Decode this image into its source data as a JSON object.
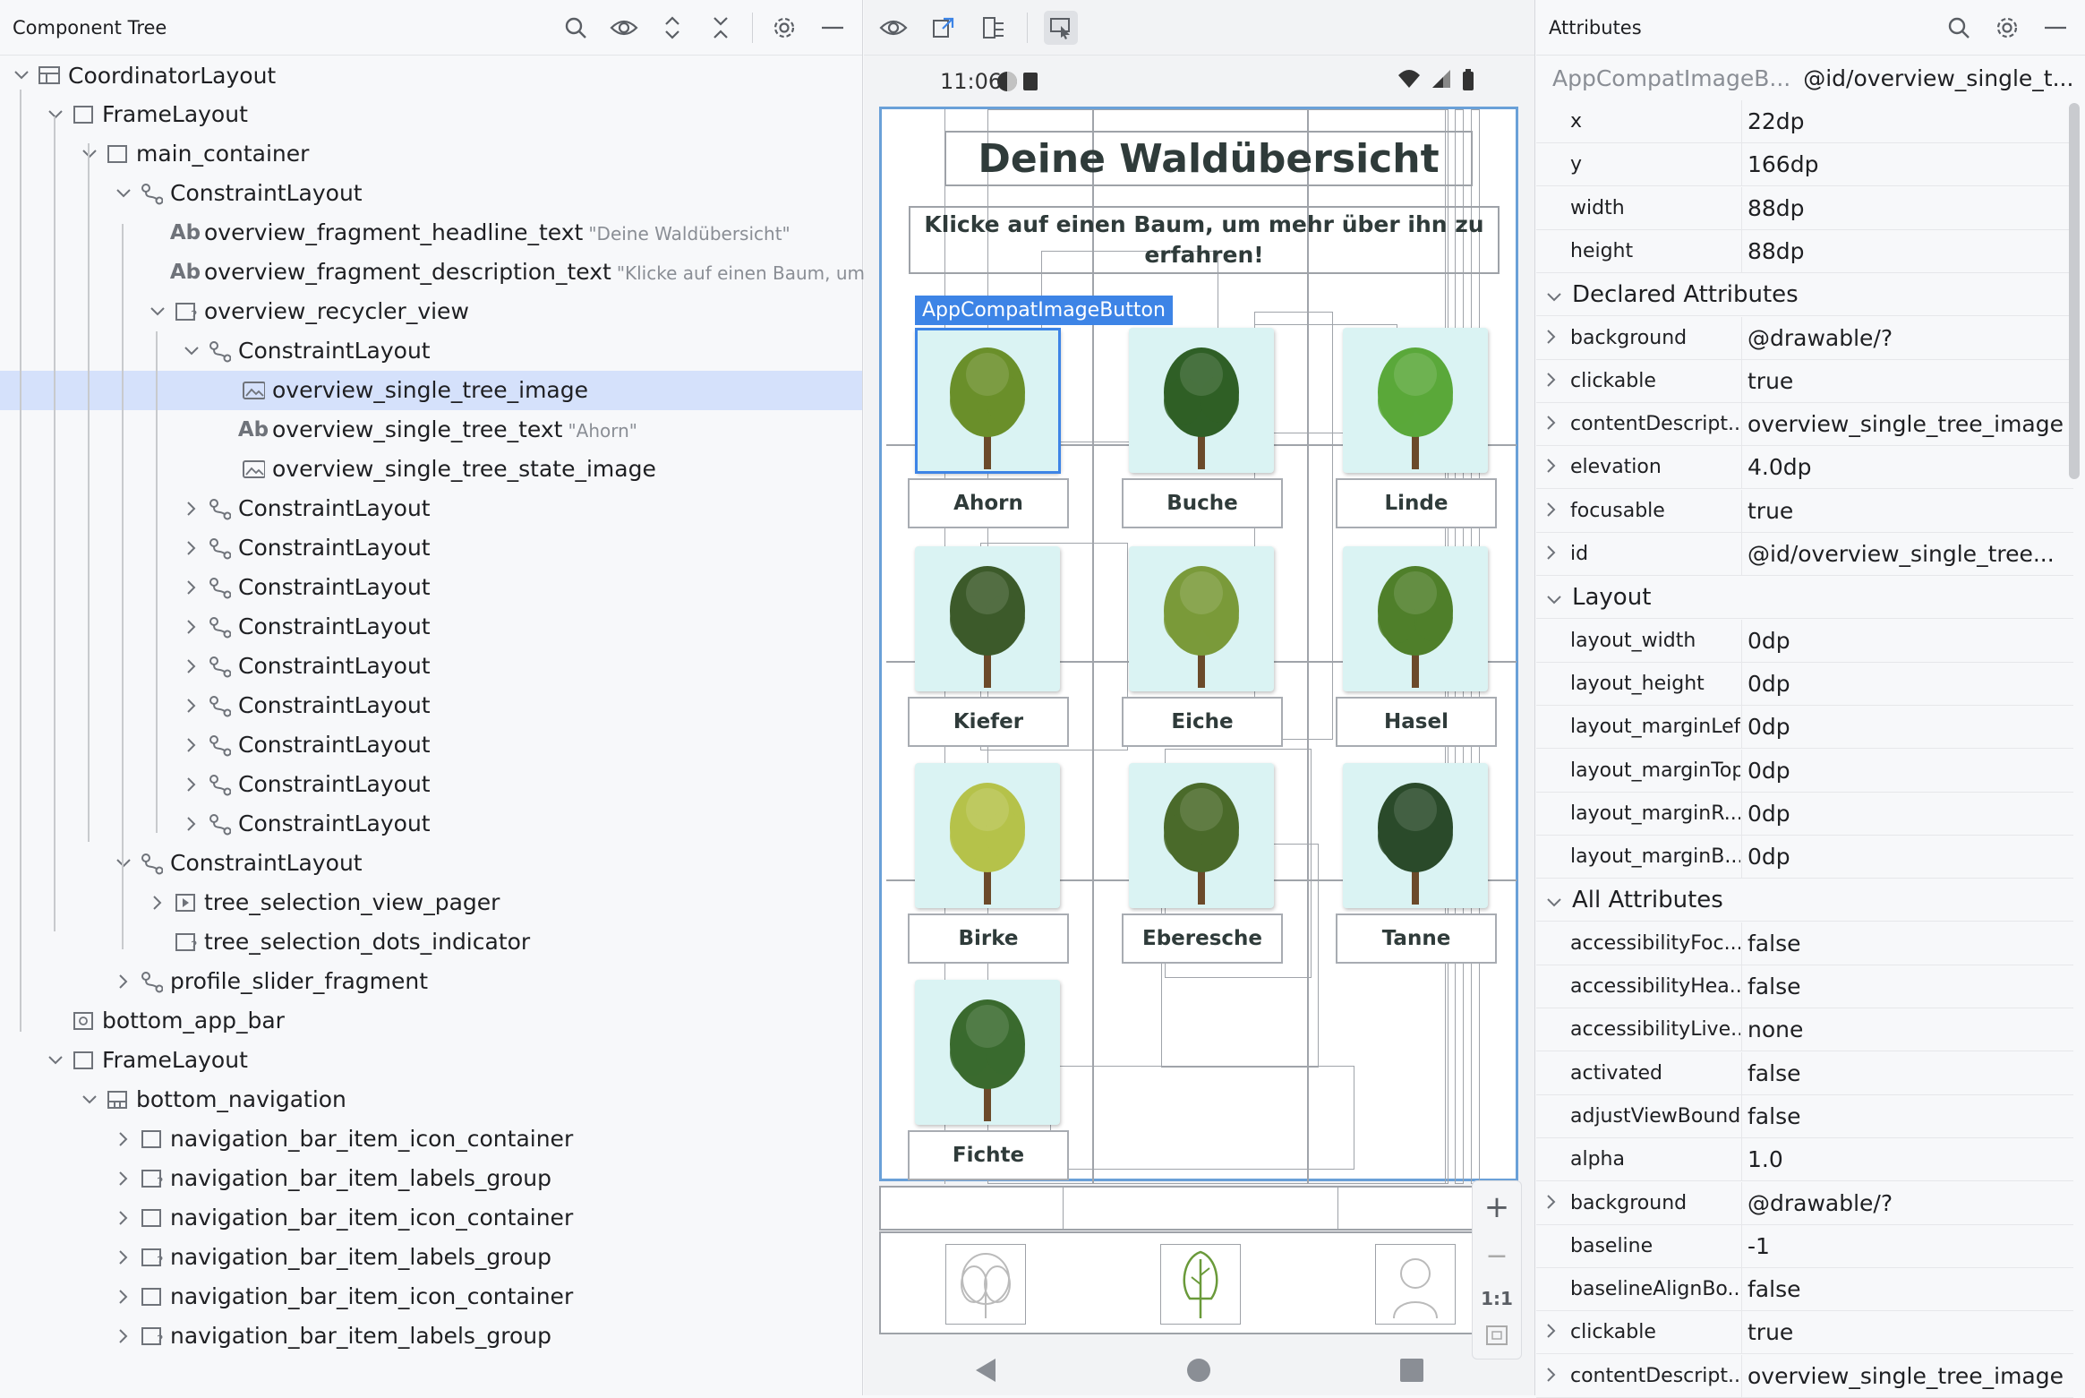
{
  "tree_panel": {
    "title": "Component Tree",
    "icons": [
      "search-icon",
      "eye-icon",
      "expand-icon",
      "collapse-icon",
      "gear-icon",
      "minimize-icon"
    ],
    "nodes": [
      {
        "label": "CoordinatorLayout",
        "sub": "",
        "icon": "coordinator-icon",
        "expanded": true,
        "has_chevron": true
      },
      {
        "label": "FrameLayout",
        "sub": "",
        "icon": "frame-icon",
        "expanded": true,
        "has_chevron": true
      },
      {
        "label": "main_container",
        "sub": "",
        "icon": "frame-icon",
        "expanded": true,
        "has_chevron": true
      },
      {
        "label": "ConstraintLayout",
        "sub": "",
        "icon": "constraint-icon",
        "expanded": true,
        "has_chevron": true
      },
      {
        "label": "overview_fragment_headline_text",
        "sub": "\"Deine Waldübersicht\"",
        "icon": "text-icon",
        "has_chevron": false
      },
      {
        "label": "overview_fragment_description_text",
        "sub": "\"Klicke auf einen Baum, um ...",
        "icon": "text-icon",
        "has_chevron": false
      },
      {
        "label": "overview_recycler_view",
        "sub": "",
        "icon": "recycler-icon",
        "expanded": true,
        "has_chevron": true
      },
      {
        "label": "ConstraintLayout",
        "sub": "",
        "icon": "constraint-icon",
        "expanded": true,
        "has_chevron": true
      },
      {
        "label": "overview_single_tree_image",
        "sub": "",
        "icon": "image-icon",
        "has_chevron": false,
        "selected": true
      },
      {
        "label": "overview_single_tree_text",
        "sub": "\"Ahorn\"",
        "icon": "text-icon",
        "has_chevron": false
      },
      {
        "label": "overview_single_tree_state_image",
        "sub": "",
        "icon": "image-icon",
        "has_chevron": false
      },
      {
        "label": "ConstraintLayout",
        "sub": "",
        "icon": "constraint-icon",
        "expanded": false,
        "has_chevron": true
      },
      {
        "label": "ConstraintLayout",
        "sub": "",
        "icon": "constraint-icon",
        "expanded": false,
        "has_chevron": true
      },
      {
        "label": "ConstraintLayout",
        "sub": "",
        "icon": "constraint-icon",
        "expanded": false,
        "has_chevron": true
      },
      {
        "label": "ConstraintLayout",
        "sub": "",
        "icon": "constraint-icon",
        "expanded": false,
        "has_chevron": true
      },
      {
        "label": "ConstraintLayout",
        "sub": "",
        "icon": "constraint-icon",
        "expanded": false,
        "has_chevron": true
      },
      {
        "label": "ConstraintLayout",
        "sub": "",
        "icon": "constraint-icon",
        "expanded": false,
        "has_chevron": true
      },
      {
        "label": "ConstraintLayout",
        "sub": "",
        "icon": "constraint-icon",
        "expanded": false,
        "has_chevron": true
      },
      {
        "label": "ConstraintLayout",
        "sub": "",
        "icon": "constraint-icon",
        "expanded": false,
        "has_chevron": true
      },
      {
        "label": "ConstraintLayout",
        "sub": "",
        "icon": "constraint-icon",
        "expanded": false,
        "has_chevron": true
      },
      {
        "label": "ConstraintLayout",
        "sub": "",
        "icon": "constraint-icon",
        "expanded": true,
        "has_chevron": true
      },
      {
        "label": "tree_selection_view_pager",
        "sub": "",
        "icon": "pager-icon",
        "expanded": false,
        "has_chevron": true
      },
      {
        "label": "tree_selection_dots_indicator",
        "sub": "",
        "icon": "unknown-view-icon",
        "has_chevron": false
      },
      {
        "label": "profile_slider_fragment",
        "sub": "",
        "icon": "constraint-icon",
        "expanded": false,
        "has_chevron": true
      },
      {
        "label": "bottom_app_bar",
        "sub": "",
        "icon": "appbar-icon",
        "has_chevron": false
      },
      {
        "label": "FrameLayout",
        "sub": "",
        "icon": "frame-icon",
        "expanded": true,
        "has_chevron": true
      },
      {
        "label": "bottom_navigation",
        "sub": "",
        "icon": "bottom-nav-icon",
        "expanded": true,
        "has_chevron": true
      },
      {
        "label": "navigation_bar_item_icon_container",
        "sub": "",
        "icon": "frame-icon",
        "expanded": false,
        "has_chevron": true
      },
      {
        "label": "navigation_bar_item_labels_group",
        "sub": "",
        "icon": "unknown-view-icon",
        "expanded": false,
        "has_chevron": true
      },
      {
        "label": "navigation_bar_item_icon_container",
        "sub": "",
        "icon": "frame-icon",
        "expanded": false,
        "has_chevron": true
      },
      {
        "label": "navigation_bar_item_labels_group",
        "sub": "",
        "icon": "unknown-view-icon",
        "expanded": false,
        "has_chevron": true
      },
      {
        "label": "navigation_bar_item_icon_container",
        "sub": "",
        "icon": "frame-icon",
        "expanded": false,
        "has_chevron": true
      },
      {
        "label": "navigation_bar_item_labels_group",
        "sub": "",
        "icon": "unknown-view-icon",
        "expanded": false,
        "has_chevron": true
      }
    ]
  },
  "preview": {
    "toolbar_icons": [
      "eye-icon",
      "export-icon",
      "layout-tree-icon",
      "select-mode-icon"
    ],
    "status_time": "11:06",
    "headline": "Deine Waldübersicht",
    "description": "Klicke auf einen Baum, um mehr über ihn zu erfahren!",
    "selected_tag": "AppCompatImageButton",
    "trees": [
      {
        "name": "Ahorn",
        "color": "#6a8f2a"
      },
      {
        "name": "Buche",
        "color": "#2f5f26"
      },
      {
        "name": "Linde",
        "color": "#5aa83a"
      },
      {
        "name": "Kiefer",
        "color": "#3c5a2a"
      },
      {
        "name": "Eiche",
        "color": "#7a9a3a"
      },
      {
        "name": "Hasel",
        "color": "#4f7f2a"
      },
      {
        "name": "Birke",
        "color": "#b5c24a"
      },
      {
        "name": "Eberesche",
        "color": "#4a6a2a"
      },
      {
        "name": "Tanne",
        "color": "#2a4a2a"
      },
      {
        "name": "Fichte",
        "color": "#3a6a2e"
      }
    ],
    "zoom": {
      "plus": "+",
      "minus": "−",
      "ratio": "1:1"
    }
  },
  "attr_panel": {
    "title": "Attributes",
    "component_class": "AppCompatImageB...",
    "component_id": "@id/overview_single_t...",
    "basic": [
      {
        "name": "x",
        "value": "22dp"
      },
      {
        "name": "y",
        "value": "166dp"
      },
      {
        "name": "width",
        "value": "88dp"
      },
      {
        "name": "height",
        "value": "88dp"
      }
    ],
    "sections": {
      "declared": "Declared Attributes",
      "layout": "Layout",
      "all": "All Attributes"
    },
    "declared": [
      {
        "name": "background",
        "value": "@drawable/?",
        "chev": true
      },
      {
        "name": "clickable",
        "value": "true",
        "chev": true
      },
      {
        "name": "contentDescript...",
        "value": "overview_single_tree_image",
        "chev": true
      },
      {
        "name": "elevation",
        "value": "4.0dp",
        "chev": true
      },
      {
        "name": "focusable",
        "value": "true",
        "chev": true
      },
      {
        "name": "id",
        "value": "@id/overview_single_tree...",
        "chev": true
      }
    ],
    "layout": [
      {
        "name": "layout_width",
        "value": "0dp"
      },
      {
        "name": "layout_height",
        "value": "0dp"
      },
      {
        "name": "layout_marginLeft",
        "value": "0dp"
      },
      {
        "name": "layout_marginTop",
        "value": "0dp"
      },
      {
        "name": "layout_marginR...",
        "value": "0dp"
      },
      {
        "name": "layout_marginB...",
        "value": "0dp"
      }
    ],
    "all": [
      {
        "name": "accessibilityFoc...",
        "value": "false",
        "chev": false
      },
      {
        "name": "accessibilityHea...",
        "value": "false",
        "chev": false
      },
      {
        "name": "accessibilityLive...",
        "value": "none",
        "chev": false
      },
      {
        "name": "activated",
        "value": "false",
        "chev": false
      },
      {
        "name": "adjustViewBounds",
        "value": "false",
        "chev": false
      },
      {
        "name": "alpha",
        "value": "1.0",
        "chev": false
      },
      {
        "name": "background",
        "value": "@drawable/?",
        "chev": true
      },
      {
        "name": "baseline",
        "value": "-1",
        "chev": false
      },
      {
        "name": "baselineAlignBo...",
        "value": "false",
        "chev": false
      },
      {
        "name": "clickable",
        "value": "true",
        "chev": true
      },
      {
        "name": "contentDescript...",
        "value": "overview_single_tree_image",
        "chev": true
      }
    ]
  }
}
